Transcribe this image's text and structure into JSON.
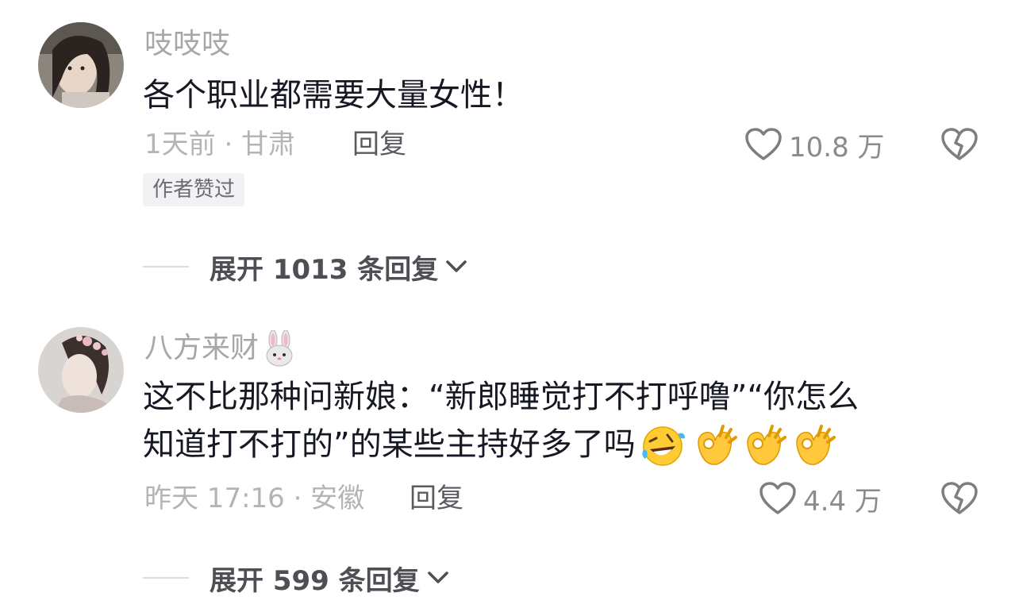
{
  "comments": [
    {
      "username": "吱吱吱",
      "content": "各个职业都需要大量女性！",
      "time_location": "1天前 · 甘肃",
      "reply_label": "回复",
      "likes": "10.8 万",
      "badge": "作者赞过",
      "expand_label": "展开 1013 条回复"
    },
    {
      "username": "八方来财",
      "username_emoji": "rabbit-face-icon",
      "content_line1": "这不比那种问新娘：“新郎睡觉打不打呼噜”“你怎么",
      "content_line2": "知道打不打的”的某些主持好多了吗",
      "content_emojis": [
        "rolling-laughing-icon",
        "ok-hand-icon",
        "ok-hand-icon",
        "ok-hand-icon"
      ],
      "time_location": "昨天 17:16 · 安徽",
      "reply_label": "回复",
      "likes": "4.4 万",
      "expand_label": "展开 599 条回复"
    }
  ],
  "colors": {
    "primary_text": "#161823",
    "secondary_text": "#a6a6ab",
    "badge_bg": "#f2f2f4"
  }
}
